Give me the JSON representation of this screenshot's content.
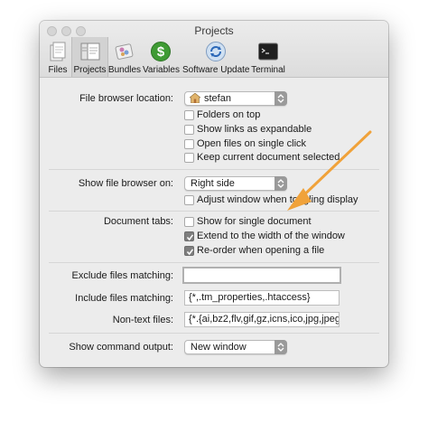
{
  "window": {
    "title": "Projects"
  },
  "toolbar": {
    "tabs": [
      {
        "label": "Files",
        "icon": "files-icon"
      },
      {
        "label": "Projects",
        "icon": "projects-icon",
        "selected": true
      },
      {
        "label": "Bundles",
        "icon": "bundles-icon"
      },
      {
        "label": "Variables",
        "icon": "variables-icon"
      },
      {
        "label": "Software Update",
        "icon": "software-update-icon"
      },
      {
        "label": "Terminal",
        "icon": "terminal-icon"
      }
    ]
  },
  "file_browser": {
    "location_label": "File browser location:",
    "location_value": "stefan",
    "options": [
      {
        "label": "Folders on top",
        "checked": false
      },
      {
        "label": "Show links as expandable",
        "checked": false
      },
      {
        "label": "Open files on single click",
        "checked": false
      },
      {
        "label": "Keep current document selected",
        "checked": false
      }
    ]
  },
  "show_browser": {
    "label": "Show file browser on:",
    "value": "Right side",
    "option": {
      "label": "Adjust window when toggling display",
      "checked": false
    }
  },
  "document_tabs": {
    "label": "Document tabs:",
    "options": [
      {
        "label": "Show for single document",
        "checked": false
      },
      {
        "label": "Extend to the width of the window",
        "checked": true
      },
      {
        "label": "Re-order when opening a file",
        "checked": true
      }
    ]
  },
  "patterns": {
    "exclude_label": "Exclude files matching:",
    "exclude_value": "",
    "include_label": "Include files matching:",
    "include_value": "{*,.tm_properties,.htaccess}",
    "nontext_label": "Non-text files:",
    "nontext_value": "{*.{ai,bz2,flv,gif,gz,icns,ico,jpg,jpeg,"
  },
  "command_output": {
    "label": "Show command output:",
    "value": "New window"
  },
  "colors": {
    "annotation_arrow": "#f0a23a",
    "checkbox_checked": "#7e7e7e"
  }
}
